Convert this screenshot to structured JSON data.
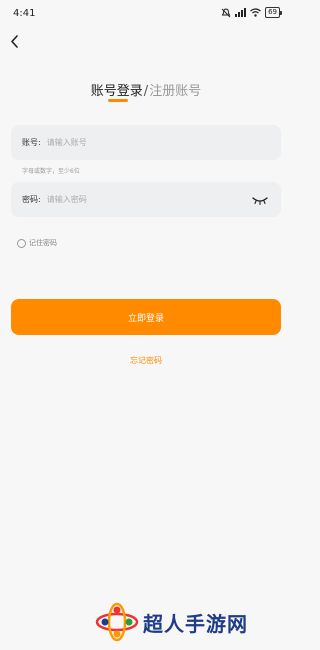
{
  "status_bar": {
    "time": "4:41",
    "battery": "69"
  },
  "tabs": {
    "active": "账号登录",
    "separator": "/",
    "inactive": "注册账号"
  },
  "account": {
    "label": "账号:",
    "placeholder": "请输入账号",
    "hint": "字母或数字，至少6位"
  },
  "password": {
    "label": "密码:",
    "placeholder": "请输入密码"
  },
  "remember": {
    "label": "记住密码"
  },
  "login_button": {
    "label": "立即登录"
  },
  "forgot": {
    "label": "忘记密码"
  },
  "watermark": {
    "text": "超人手游网"
  },
  "colors": {
    "accent": "#ff8a00",
    "background": "#f7f7f8",
    "field_bg": "#eeeff1",
    "watermark": "#1f3c88"
  },
  "icons": {
    "back": "chevron-left-icon",
    "eye": "eye-closed-icon",
    "wifi": "wifi-icon",
    "signal": "signal-icon",
    "mute": "bell-off-icon"
  }
}
